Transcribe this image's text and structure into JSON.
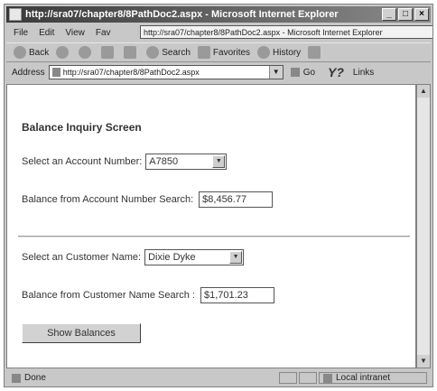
{
  "window": {
    "title": "http://sra07/chapter8/8PathDoc2.aspx - Microsoft Internet Explorer",
    "minimize": "_",
    "maximize": "□",
    "close": "×"
  },
  "menu": {
    "items": [
      "File",
      "Edit",
      "View",
      "Fav"
    ],
    "tooltip_url": "http://sra07/chapter8/8PathDoc2.aspx - Microsoft Internet Explorer"
  },
  "toolbar": {
    "back": "Back",
    "search": "Search",
    "favorites": "Favorites",
    "history": "History"
  },
  "address": {
    "label": "Address",
    "url": "http://sra07/chapter8/8PathDoc2.aspx",
    "go": "Go",
    "links": "Links"
  },
  "page": {
    "heading": "Balance Inquiry Screen",
    "account_label": "Select an Account Number:",
    "account_selected": "A7850",
    "balance_account_label": "Balance from Account Number Search:",
    "balance_account_value": "$8,456.77",
    "customer_label": "Select an Customer Name:",
    "customer_selected": "Dixie Dyke",
    "balance_customer_label": "Balance from Customer Name Search :",
    "balance_customer_value": "$1,701.23",
    "show_button": "Show Balances"
  },
  "status": {
    "done": "Done",
    "zone": "Local intranet"
  }
}
